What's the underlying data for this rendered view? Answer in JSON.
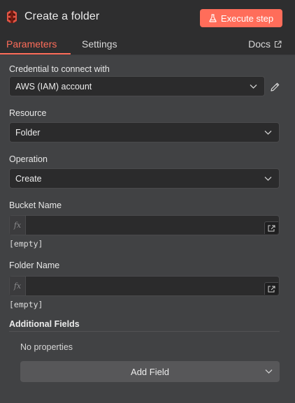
{
  "header": {
    "title": "Create a folder",
    "execute_label": "Execute step",
    "node_icon": "aws-s3-icon",
    "accent_color": "#ff6d5a"
  },
  "tabs": {
    "items": [
      {
        "label": "Parameters",
        "active": true
      },
      {
        "label": "Settings",
        "active": false
      }
    ],
    "docs_label": "Docs"
  },
  "form": {
    "credential": {
      "label": "Credential to connect with",
      "value": "AWS (IAM) account"
    },
    "resource": {
      "label": "Resource",
      "value": "Folder"
    },
    "operation": {
      "label": "Operation",
      "value": "Create"
    },
    "bucket_name": {
      "label": "Bucket Name",
      "value": "",
      "fx": "fx",
      "hint": "[empty]"
    },
    "folder_name": {
      "label": "Folder Name",
      "value": "",
      "fx": "fx",
      "hint": "[empty]"
    },
    "additional_fields": {
      "label": "Additional Fields",
      "no_properties": "No properties",
      "add_field_label": "Add Field"
    }
  }
}
